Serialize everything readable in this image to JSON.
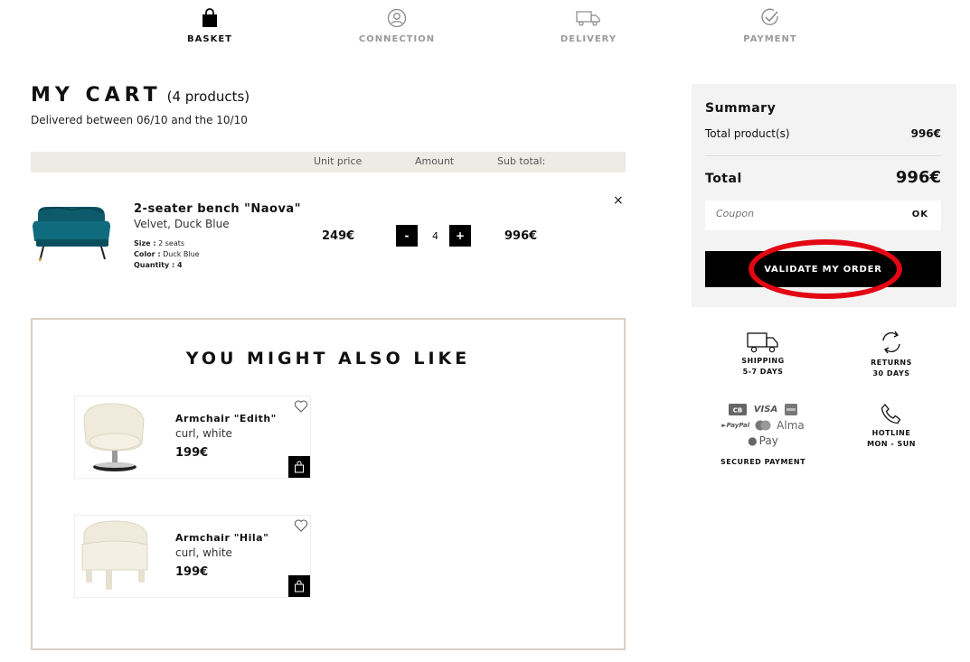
{
  "steps": [
    {
      "label": "BASKET",
      "icon": "shopping-bag-icon",
      "active": true
    },
    {
      "label": "CONNECTION",
      "icon": "user-circle-icon",
      "active": false
    },
    {
      "label": "DELIVERY",
      "icon": "delivery-truck-icon",
      "active": false
    },
    {
      "label": "PAYMENT",
      "icon": "check-circle-icon",
      "active": false
    }
  ],
  "cart": {
    "title": "MY CART",
    "count": "(4 products)",
    "delivered": "Delivered between 06/10 and the 10/10",
    "headers": {
      "unit_price": "Unit price",
      "amount": "Amount",
      "subtotal": "Sub total:"
    },
    "item": {
      "name": "2-seater bench \"Naova\"",
      "variant": "Velvet, Duck Blue",
      "size_label": "Size :",
      "size_value": "2 seats",
      "color_label": "Color :",
      "color_value": "Duck Blue",
      "quantity_label": "Quantity : 4",
      "unit_price": "249€",
      "minus": "-",
      "quantity": "4",
      "plus": "+",
      "subtotal": "996€",
      "remove": "×"
    }
  },
  "recommendations": {
    "title": "YOU MIGHT ALSO LIKE",
    "items": [
      {
        "name": "Armchair \"Edith\"",
        "sub": "curl, white",
        "price": "199€"
      },
      {
        "name": "Armchair \"Hila\"",
        "sub": "curl, white",
        "price": "199€"
      }
    ]
  },
  "summary": {
    "title": "Summary",
    "total_products_label": "Total product(s)",
    "total_products_value": "996€",
    "total_label": "Total",
    "total_value": "996€",
    "coupon_placeholder": "Coupon",
    "ok_label": "OK",
    "validate_label": "VALIDATE MY ORDER"
  },
  "reassurance": {
    "shipping_1": "SHIPPING",
    "shipping_2": "5-7 DAYS",
    "returns_1": "RETURNS",
    "returns_2": "30 DAYS",
    "hotline_1": "HOTLINE",
    "hotline_2": "MON - SUN",
    "secured": "SECURED PAYMENT",
    "pay_visa": "VISA",
    "pay_paypal": "PayPal",
    "pay_alma": "Alma",
    "pay_apple": "Pay"
  },
  "colors": {
    "accent": "#000000",
    "highlight": "#e30613",
    "panel": "#f3f3f3",
    "beige": "#eeebe5"
  }
}
